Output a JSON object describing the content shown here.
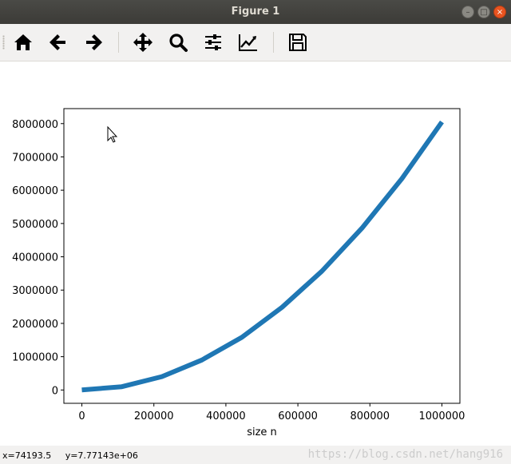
{
  "window": {
    "title": "Figure 1",
    "buttons": {
      "minimize": "–",
      "maximize": "□",
      "close": "×"
    }
  },
  "toolbar": {
    "items": [
      {
        "name": "home",
        "icon": "home-icon"
      },
      {
        "name": "back",
        "icon": "arrow-left-icon"
      },
      {
        "name": "forward",
        "icon": "arrow-right-icon"
      },
      {
        "name": "pan",
        "icon": "move-icon"
      },
      {
        "name": "zoom",
        "icon": "magnifier-icon"
      },
      {
        "name": "subplots",
        "icon": "sliders-icon"
      },
      {
        "name": "edit-axes",
        "icon": "line-chart-icon"
      },
      {
        "name": "save",
        "icon": "floppy-disk-icon"
      }
    ]
  },
  "chart_data": {
    "type": "line",
    "title": "",
    "xlabel": "size n",
    "ylabel": "",
    "x": [
      0,
      111111,
      222222,
      333333,
      444444,
      555556,
      666667,
      777778,
      888889,
      1000000
    ],
    "series": [
      {
        "color": "#1f77b4",
        "values": [
          10,
          100000,
          400000,
          900000,
          1580000,
          2480000,
          3570000,
          4860000,
          6350000,
          8050000
        ]
      }
    ],
    "xlim": [
      -50000,
      1050000
    ],
    "ylim": [
      -400000,
      8450000
    ],
    "xticks": [
      0,
      200000,
      400000,
      600000,
      800000,
      1000000
    ],
    "xtick_labels": [
      "0",
      "200000",
      "400000",
      "600000",
      "800000",
      "1000000"
    ],
    "yticks": [
      0,
      1000000,
      2000000,
      3000000,
      4000000,
      5000000,
      6000000,
      7000000,
      8000000
    ],
    "ytick_labels": [
      "0",
      "1000000",
      "2000000",
      "3000000",
      "4000000",
      "5000000",
      "6000000",
      "7000000",
      "8000000"
    ],
    "grid": false,
    "line_color": "#1f77b4"
  },
  "statusbar": {
    "x_readout": "x=74193.5",
    "y_readout": "y=7.77143e+06",
    "watermark": "https://blog.csdn.net/hang916"
  }
}
